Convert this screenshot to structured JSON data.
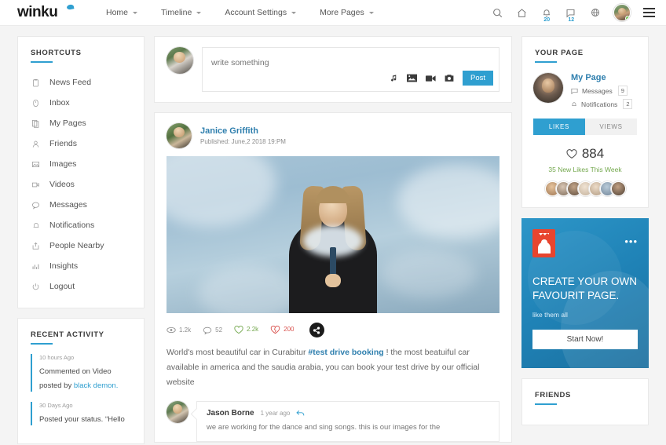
{
  "brand": {
    "name": "winku"
  },
  "nav": [
    {
      "label": "Home",
      "has_caret": true
    },
    {
      "label": "Timeline",
      "has_caret": true
    },
    {
      "label": "Account Settings",
      "has_caret": true
    },
    {
      "label": "More Pages",
      "has_caret": true
    }
  ],
  "header_icons": {
    "search": "search-icon",
    "home": "home-icon",
    "notifications": {
      "icon": "bell-icon",
      "badge": "20"
    },
    "messages": {
      "icon": "chat-icon",
      "badge": "12"
    },
    "globe": "globe-icon",
    "avatar": "user-avatar",
    "menu": "hamburger-icon"
  },
  "sidebar": {
    "title": "SHORTCUTS",
    "items": [
      {
        "label": "News Feed",
        "icon": "news-feed-icon"
      },
      {
        "label": "Inbox",
        "icon": "inbox-icon"
      },
      {
        "label": "My Pages",
        "icon": "pages-icon"
      },
      {
        "label": "Friends",
        "icon": "friends-icon"
      },
      {
        "label": "Images",
        "icon": "images-icon"
      },
      {
        "label": "Videos",
        "icon": "videos-icon"
      },
      {
        "label": "Messages",
        "icon": "messages-icon"
      },
      {
        "label": "Notifications",
        "icon": "notifications-icon"
      },
      {
        "label": "People Nearby",
        "icon": "people-nearby-icon"
      },
      {
        "label": "Insights",
        "icon": "insights-icon"
      },
      {
        "label": "Logout",
        "icon": "logout-icon"
      }
    ]
  },
  "recent_activity": {
    "title": "RECENT ACTIVITY",
    "items": [
      {
        "time": "10 hours Ago",
        "text": "Commented on Video posted by ",
        "link": "black demon."
      },
      {
        "time": "30 Days Ago",
        "text": "Posted your status. “Hello",
        "link": ""
      }
    ]
  },
  "composer": {
    "placeholder": "write something",
    "value": "",
    "post_label": "Post",
    "actions": [
      "music-icon",
      "image-icon",
      "video-icon",
      "camera-icon"
    ]
  },
  "post": {
    "author": "Janice Griffith",
    "published": "Published: June,2 2018 19:PM",
    "stats": [
      {
        "icon": "eye-icon",
        "value": "1.2k",
        "color": "#8d8d8d"
      },
      {
        "icon": "comment-icon",
        "value": "52",
        "color": "#8d8d8d"
      },
      {
        "icon": "heart-icon",
        "value": "2.2k",
        "color": "#74a84e"
      },
      {
        "icon": "broken-heart-icon",
        "value": "200",
        "color": "#d9534f"
      }
    ],
    "share": "share-icon",
    "text_before": "World's most beautiful car in Curabitur ",
    "hashtag": "#test drive booking",
    "text_after": " ! the most beatuiful car available in america and the saudia arabia, you can book your test drive by our official website"
  },
  "comment": {
    "name": "Jason Borne",
    "time": "1 year ago",
    "reply_icon": "reply-icon",
    "text": "we are working for the dance and sing songs. this is our images for the"
  },
  "your_page": {
    "title": "YOUR PAGE",
    "name": "My Page",
    "messages_label": "Messages",
    "messages_count": "9",
    "notifications_label": "Notifications",
    "notifications_count": "2",
    "tabs": [
      {
        "label": "LIKES",
        "active": true
      },
      {
        "label": "VIEWS",
        "active": false
      }
    ],
    "likes_count": "884",
    "likes_sub": "35 New Likes This Week",
    "face_colors": [
      "#b98a63",
      "#a08b7a",
      "#7d6a58",
      "#d6c3ab",
      "#c9b39b",
      "#8fa3b8",
      "#6e5d4e"
    ]
  },
  "promo": {
    "icon": "book-icon",
    "menu": "•••",
    "title": "CREATE YOUR OWN FAVOURIT PAGE.",
    "subtitle": "like them all",
    "button": "Start Now!"
  },
  "friends": {
    "title": "FRIENDS"
  },
  "colors": {
    "accent": "#2f9fd0",
    "link": "#2f7fae",
    "green": "#74a84e",
    "red": "#d9534f"
  }
}
